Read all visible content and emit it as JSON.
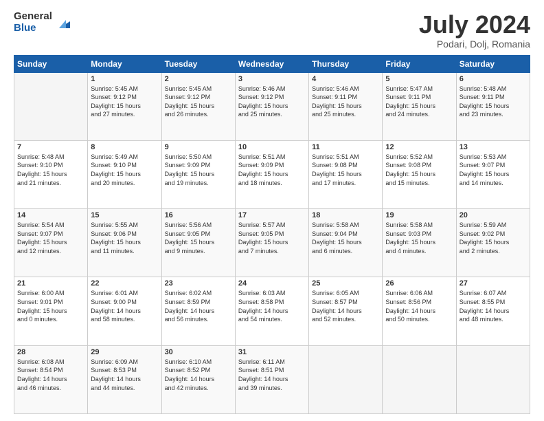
{
  "logo": {
    "general": "General",
    "blue": "Blue"
  },
  "title": "July 2024",
  "location": "Podari, Dolj, Romania",
  "days_of_week": [
    "Sunday",
    "Monday",
    "Tuesday",
    "Wednesday",
    "Thursday",
    "Friday",
    "Saturday"
  ],
  "weeks": [
    [
      {
        "day": "",
        "info": ""
      },
      {
        "day": "1",
        "info": "Sunrise: 5:45 AM\nSunset: 9:12 PM\nDaylight: 15 hours\nand 27 minutes."
      },
      {
        "day": "2",
        "info": "Sunrise: 5:45 AM\nSunset: 9:12 PM\nDaylight: 15 hours\nand 26 minutes."
      },
      {
        "day": "3",
        "info": "Sunrise: 5:46 AM\nSunset: 9:12 PM\nDaylight: 15 hours\nand 25 minutes."
      },
      {
        "day": "4",
        "info": "Sunrise: 5:46 AM\nSunset: 9:11 PM\nDaylight: 15 hours\nand 25 minutes."
      },
      {
        "day": "5",
        "info": "Sunrise: 5:47 AM\nSunset: 9:11 PM\nDaylight: 15 hours\nand 24 minutes."
      },
      {
        "day": "6",
        "info": "Sunrise: 5:48 AM\nSunset: 9:11 PM\nDaylight: 15 hours\nand 23 minutes."
      }
    ],
    [
      {
        "day": "7",
        "info": "Sunrise: 5:48 AM\nSunset: 9:10 PM\nDaylight: 15 hours\nand 21 minutes."
      },
      {
        "day": "8",
        "info": "Sunrise: 5:49 AM\nSunset: 9:10 PM\nDaylight: 15 hours\nand 20 minutes."
      },
      {
        "day": "9",
        "info": "Sunrise: 5:50 AM\nSunset: 9:09 PM\nDaylight: 15 hours\nand 19 minutes."
      },
      {
        "day": "10",
        "info": "Sunrise: 5:51 AM\nSunset: 9:09 PM\nDaylight: 15 hours\nand 18 minutes."
      },
      {
        "day": "11",
        "info": "Sunrise: 5:51 AM\nSunset: 9:08 PM\nDaylight: 15 hours\nand 17 minutes."
      },
      {
        "day": "12",
        "info": "Sunrise: 5:52 AM\nSunset: 9:08 PM\nDaylight: 15 hours\nand 15 minutes."
      },
      {
        "day": "13",
        "info": "Sunrise: 5:53 AM\nSunset: 9:07 PM\nDaylight: 15 hours\nand 14 minutes."
      }
    ],
    [
      {
        "day": "14",
        "info": "Sunrise: 5:54 AM\nSunset: 9:07 PM\nDaylight: 15 hours\nand 12 minutes."
      },
      {
        "day": "15",
        "info": "Sunrise: 5:55 AM\nSunset: 9:06 PM\nDaylight: 15 hours\nand 11 minutes."
      },
      {
        "day": "16",
        "info": "Sunrise: 5:56 AM\nSunset: 9:05 PM\nDaylight: 15 hours\nand 9 minutes."
      },
      {
        "day": "17",
        "info": "Sunrise: 5:57 AM\nSunset: 9:05 PM\nDaylight: 15 hours\nand 7 minutes."
      },
      {
        "day": "18",
        "info": "Sunrise: 5:58 AM\nSunset: 9:04 PM\nDaylight: 15 hours\nand 6 minutes."
      },
      {
        "day": "19",
        "info": "Sunrise: 5:58 AM\nSunset: 9:03 PM\nDaylight: 15 hours\nand 4 minutes."
      },
      {
        "day": "20",
        "info": "Sunrise: 5:59 AM\nSunset: 9:02 PM\nDaylight: 15 hours\nand 2 minutes."
      }
    ],
    [
      {
        "day": "21",
        "info": "Sunrise: 6:00 AM\nSunset: 9:01 PM\nDaylight: 15 hours\nand 0 minutes."
      },
      {
        "day": "22",
        "info": "Sunrise: 6:01 AM\nSunset: 9:00 PM\nDaylight: 14 hours\nand 58 minutes."
      },
      {
        "day": "23",
        "info": "Sunrise: 6:02 AM\nSunset: 8:59 PM\nDaylight: 14 hours\nand 56 minutes."
      },
      {
        "day": "24",
        "info": "Sunrise: 6:03 AM\nSunset: 8:58 PM\nDaylight: 14 hours\nand 54 minutes."
      },
      {
        "day": "25",
        "info": "Sunrise: 6:05 AM\nSunset: 8:57 PM\nDaylight: 14 hours\nand 52 minutes."
      },
      {
        "day": "26",
        "info": "Sunrise: 6:06 AM\nSunset: 8:56 PM\nDaylight: 14 hours\nand 50 minutes."
      },
      {
        "day": "27",
        "info": "Sunrise: 6:07 AM\nSunset: 8:55 PM\nDaylight: 14 hours\nand 48 minutes."
      }
    ],
    [
      {
        "day": "28",
        "info": "Sunrise: 6:08 AM\nSunset: 8:54 PM\nDaylight: 14 hours\nand 46 minutes."
      },
      {
        "day": "29",
        "info": "Sunrise: 6:09 AM\nSunset: 8:53 PM\nDaylight: 14 hours\nand 44 minutes."
      },
      {
        "day": "30",
        "info": "Sunrise: 6:10 AM\nSunset: 8:52 PM\nDaylight: 14 hours\nand 42 minutes."
      },
      {
        "day": "31",
        "info": "Sunrise: 6:11 AM\nSunset: 8:51 PM\nDaylight: 14 hours\nand 39 minutes."
      },
      {
        "day": "",
        "info": ""
      },
      {
        "day": "",
        "info": ""
      },
      {
        "day": "",
        "info": ""
      }
    ]
  ]
}
